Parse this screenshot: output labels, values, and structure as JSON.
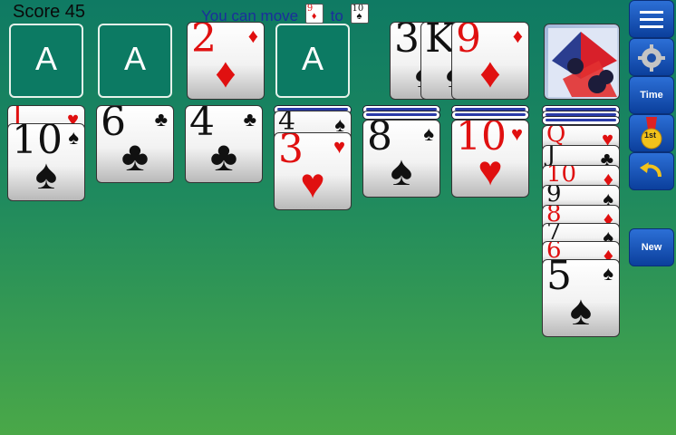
{
  "header": {
    "score": "Score 45",
    "hint_prefix": "You can move",
    "hint_mid": "to",
    "hint_card1": "9",
    "hint_card2": "10"
  },
  "foundations": [
    "A",
    "A",
    "A"
  ],
  "foundation_card": {
    "rank": "2",
    "suit": "♦"
  },
  "waste": [
    {
      "rank": "3",
      "suit": "♠"
    },
    {
      "rank": "K",
      "suit": "♠"
    },
    {
      "rank": "9",
      "suit": "♦"
    }
  ],
  "tableau": [
    {
      "cards": [
        {
          "rank": "J",
          "suit": "♥"
        },
        {
          "rank": "10",
          "suit": "♠"
        }
      ]
    },
    {
      "cards": [
        {
          "rank": "6",
          "suit": "♣"
        }
      ]
    },
    {
      "cards": [
        {
          "rank": "4",
          "suit": "♣"
        }
      ]
    },
    {
      "cards": [
        {
          "rank": "4",
          "suit": "♠"
        },
        {
          "rank": "3",
          "suit": "♥"
        }
      ]
    },
    {
      "cards": [
        {
          "rank": "8",
          "suit": "♠"
        }
      ]
    },
    {
      "cards": [
        {
          "rank": "10",
          "suit": "♥"
        }
      ]
    },
    {
      "cards": [
        {
          "rank": "Q",
          "suit": "♥"
        },
        {
          "rank": "J",
          "suit": "♣"
        },
        {
          "rank": "10",
          "suit": "♦"
        },
        {
          "rank": "9",
          "suit": "♠"
        },
        {
          "rank": "8",
          "suit": "♦"
        },
        {
          "rank": "7",
          "suit": "♠"
        },
        {
          "rank": "6",
          "suit": "♦"
        },
        {
          "rank": "5",
          "suit": "♠"
        }
      ]
    }
  ],
  "buttons": {
    "time": "Time",
    "new": "New",
    "medal": "1st"
  },
  "colors": {
    "button": "#1659c4",
    "red_suit": "#e01010",
    "felt": "#1f8a5e"
  }
}
